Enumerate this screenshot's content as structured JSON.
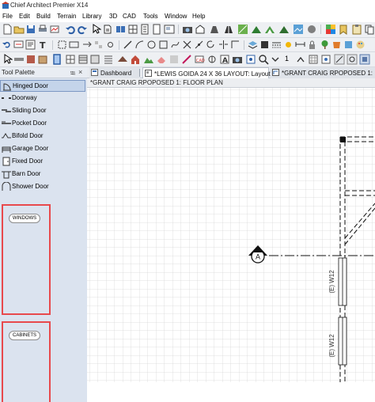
{
  "window": {
    "title": "Chief Architect Premier X14"
  },
  "menu": {
    "items": [
      "File",
      "Edit",
      "Build",
      "Terrain",
      "Library",
      "3D",
      "CAD",
      "Tools",
      "Window",
      "Help"
    ]
  },
  "toolbar3": {
    "number_value": "1"
  },
  "tool_palette": {
    "title": "Tool Palette",
    "pin_glyph": "⭾",
    "close_glyph": "×",
    "items": [
      {
        "label": "Hinged Door",
        "icon": "hinged-door-icon"
      },
      {
        "label": "Doorway",
        "icon": "doorway-icon"
      },
      {
        "label": "Sliding Door",
        "icon": "sliding-door-icon"
      },
      {
        "label": "Pocket Door",
        "icon": "pocket-door-icon"
      },
      {
        "label": "Bifold Door",
        "icon": "bifold-door-icon"
      },
      {
        "label": "Garage Door",
        "icon": "garage-door-icon"
      },
      {
        "label": "Fixed Door",
        "icon": "fixed-door-icon"
      },
      {
        "label": "Barn Door",
        "icon": "barn-door-icon"
      },
      {
        "label": "Shower Door",
        "icon": "shower-door-icon"
      }
    ],
    "selected_index": 0,
    "sections": [
      {
        "label": "WINDOWS"
      },
      {
        "label": "CABINETS"
      }
    ],
    "highlight_color": "#e8494c"
  },
  "tabs": [
    {
      "label": "Dashboard",
      "active": false
    },
    {
      "label": "*LEWIS GOIDA 24 X 36 LAYOUT: Layout",
      "active": true
    },
    {
      "label": "*GRANT CRAIG RPOPOSED 1:",
      "active": false
    }
  ],
  "view": {
    "title": "*GRANT CRAIG RPOPOSED 1:  FLOOR PLAN"
  },
  "plan": {
    "section_marker_label": "A",
    "window_labels": [
      "(E) W12",
      "(E) W12"
    ]
  }
}
